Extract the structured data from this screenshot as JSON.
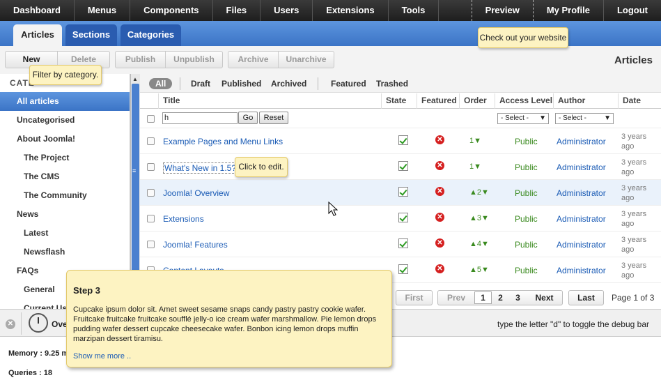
{
  "topnav": {
    "items": [
      "Dashboard",
      "Menus",
      "Components",
      "Files",
      "Users",
      "Extensions",
      "Tools"
    ],
    "right": [
      "Preview",
      "My Profile",
      "Logout"
    ]
  },
  "tabs": [
    "Articles",
    "Sections",
    "Categories"
  ],
  "toolbar": {
    "groups": [
      [
        "New",
        "Delete"
      ],
      [
        "Publish",
        "Unpublish"
      ],
      [
        "Archive",
        "Unarchive"
      ]
    ],
    "page_heading": "Articles"
  },
  "tooltips": {
    "preview": "Check out your website",
    "filter": "Filter by category.",
    "edit": "Click to edit."
  },
  "sidebar": {
    "title": "CATE",
    "items": [
      {
        "label": "All articles",
        "level": 0,
        "active": true
      },
      {
        "label": "Uncategorised",
        "level": 0
      },
      {
        "label": "About Joomla!",
        "level": 0
      },
      {
        "label": "The Project",
        "level": 1
      },
      {
        "label": "The CMS",
        "level": 1
      },
      {
        "label": "The Community",
        "level": 1
      },
      {
        "label": "News",
        "level": 0
      },
      {
        "label": "Latest",
        "level": 1
      },
      {
        "label": "Newsflash",
        "level": 1
      },
      {
        "label": "FAQs",
        "level": 0
      },
      {
        "label": "General",
        "level": 1
      },
      {
        "label": "Current Use",
        "level": 1
      }
    ]
  },
  "filters": [
    "All",
    "Draft",
    "Published",
    "Archived",
    "Featured",
    "Trashed"
  ],
  "columns": [
    "Title",
    "State",
    "Featured",
    "Order",
    "Access Level",
    "Author",
    "Date"
  ],
  "search": {
    "value": "h",
    "go": "Go",
    "reset": "Reset",
    "select_access": "- Select -",
    "select_author": "- Select -"
  },
  "rows": [
    {
      "title": "Example Pages and Menu Links",
      "order": "1",
      "up": false,
      "access": "Public",
      "author": "Administrator",
      "date": "3 years ago"
    },
    {
      "title": "What's New in 1.5?",
      "order": "1",
      "up": false,
      "access": "Public",
      "author": "Administrator",
      "date": "3 years ago"
    },
    {
      "title": "Joomla! Overview",
      "order": "2",
      "up": true,
      "access": "Public",
      "author": "Administrator",
      "date": "3 years ago"
    },
    {
      "title": "Extensions",
      "order": "3",
      "up": true,
      "access": "Public",
      "author": "Administrator",
      "date": "3 years ago"
    },
    {
      "title": "Joomla! Features",
      "order": "4",
      "up": true,
      "access": "Public",
      "author": "Administrator",
      "date": "3 years ago"
    },
    {
      "title": "Content Layouts",
      "order": "5",
      "up": true,
      "access": "Public",
      "author": "Administrator",
      "date": "3 years ago"
    }
  ],
  "pagination": {
    "first": "First",
    "prev": "Prev",
    "pages": [
      "1",
      "2",
      "3"
    ],
    "next": "Next",
    "last": "Last",
    "info": "Page 1 of 3"
  },
  "debug": {
    "tab": "Ove",
    "hint": "type the letter \"d\" to toggle the debug bar",
    "memory": "Memory : 9.25 m",
    "queries": "Queries : 18"
  },
  "step": {
    "title": "Step 3",
    "body": "Cupcake ipsum dolor sit. Amet sweet sesame snaps candy pastry pastry cookie wafer. Fruitcake fruitcake fruitcake soufflé jelly-o ice cream wafer marshmallow. Pie lemon drops pudding wafer dessert cupcake cheesecake wafer. Bonbon icing lemon drops muffin marzipan dessert tiramisu.",
    "link": "Show me more .."
  }
}
